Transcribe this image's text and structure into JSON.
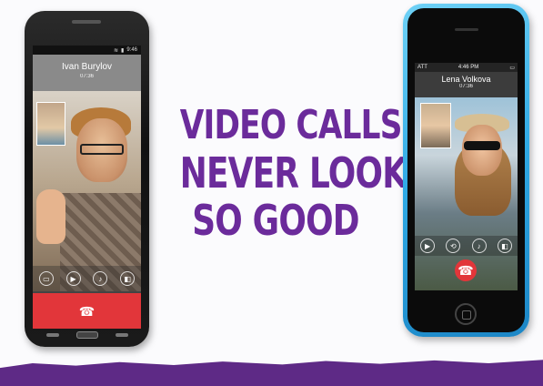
{
  "headline": {
    "line1": "VIDEO CALLS",
    "line2": "NEVER LOOKED",
    "line3": "SO GOOD"
  },
  "android_call": {
    "status_time": "9:46",
    "contact_name": "Ivan Burylov",
    "duration": "07:36",
    "controls": [
      "message",
      "video",
      "mute",
      "speaker"
    ]
  },
  "iphone_call": {
    "carrier": "ATT",
    "status_time": "4:46 PM",
    "contact_name": "Lena Volkova",
    "duration": "07:36",
    "controls": [
      "video",
      "camera-switch",
      "mute",
      "speaker"
    ]
  },
  "colors": {
    "brand_purple": "#6b2b9b",
    "strip_purple": "#5e2a86",
    "end_call_red": "#e2363a",
    "iphone_body": "#2fa9e4"
  },
  "icons": {
    "end_call": "phone-hangup-icon",
    "message": "chat-bubble-icon",
    "video": "camera-icon",
    "mute": "microphone-icon",
    "speaker": "speaker-icon"
  }
}
